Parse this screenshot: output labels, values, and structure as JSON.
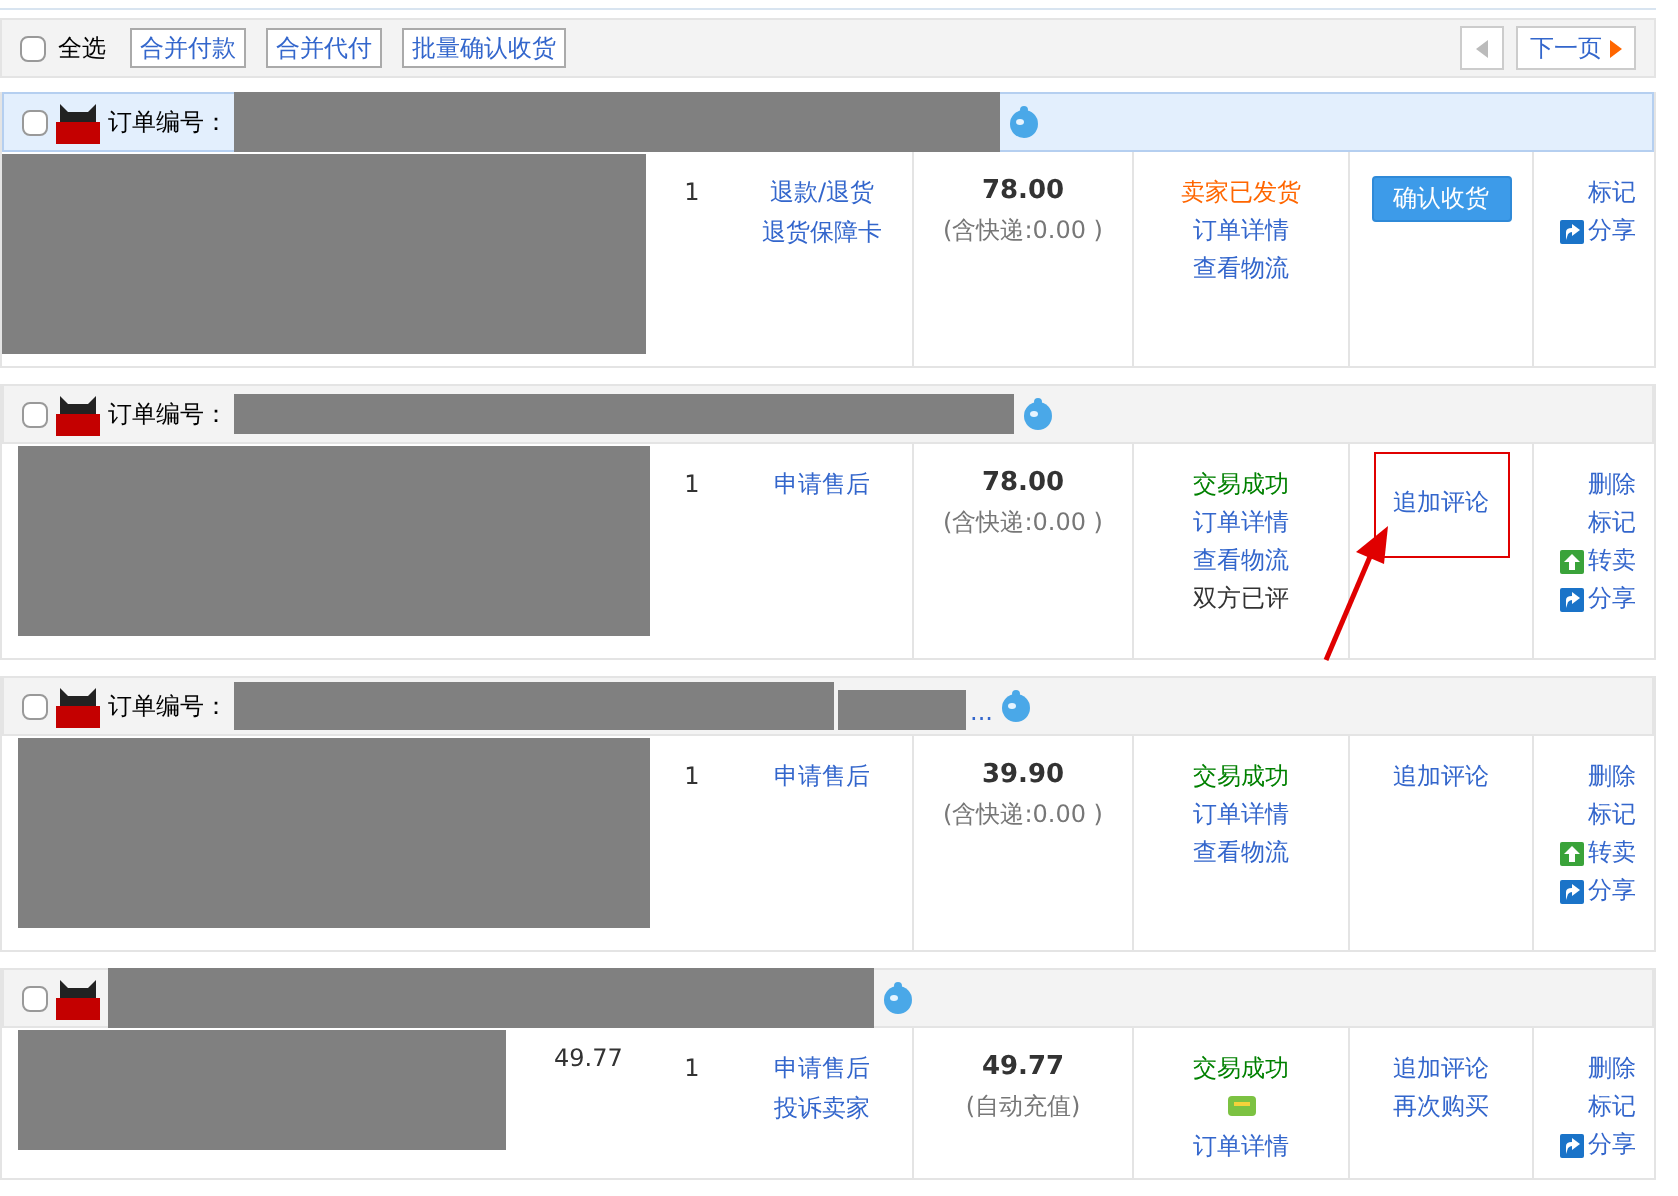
{
  "toolbar": {
    "select_all": {
      "label": "全选",
      "checked": false
    },
    "buttons": [
      "合并付款",
      "合并代付",
      "批量确认收货"
    ],
    "pager": {
      "prev_disabled": true,
      "next": "下一页"
    }
  },
  "orders": [
    {
      "highlighted": true,
      "checked": false,
      "header_label": "订单编号：",
      "qty": "1",
      "service": [
        "退款/退货",
        "退货保障卡"
      ],
      "total": "78.00",
      "total_note": "(含快递:0.00 )",
      "status": [
        {
          "kind": "shipped",
          "text": "卖家已发货"
        },
        {
          "kind": "link",
          "text": "订单详情"
        },
        {
          "kind": "link",
          "text": "查看物流"
        }
      ],
      "actions": [
        {
          "kind": "button",
          "text": "确认收货",
          "annotated": false
        }
      ],
      "misc": [
        {
          "kind": "link",
          "text": "标记"
        },
        {
          "kind": "share",
          "text": "分享"
        }
      ]
    },
    {
      "highlighted": false,
      "checked": false,
      "header_label": "订单编号：",
      "qty": "1",
      "service": [
        "申请售后"
      ],
      "total": "78.00",
      "total_note": "(含快递:0.00 )",
      "status": [
        {
          "kind": "success",
          "text": "交易成功"
        },
        {
          "kind": "link",
          "text": "订单详情"
        },
        {
          "kind": "link",
          "text": "查看物流"
        },
        {
          "kind": "text",
          "text": "双方已评"
        }
      ],
      "actions": [
        {
          "kind": "link",
          "text": "追加评论",
          "annotated": true
        }
      ],
      "misc": [
        {
          "kind": "link",
          "text": "删除"
        },
        {
          "kind": "link",
          "text": "标记"
        },
        {
          "kind": "resell",
          "text": "转卖"
        },
        {
          "kind": "share",
          "text": "分享"
        }
      ]
    },
    {
      "highlighted": false,
      "checked": false,
      "header_label": "订单编号：",
      "ellipsis": "...",
      "qty": "1",
      "service": [
        "申请售后"
      ],
      "total": "39.90",
      "total_note": "(含快递:0.00 )",
      "status": [
        {
          "kind": "success",
          "text": "交易成功"
        },
        {
          "kind": "link",
          "text": "订单详情"
        },
        {
          "kind": "link",
          "text": "查看物流"
        }
      ],
      "actions": [
        {
          "kind": "link",
          "text": "追加评论",
          "annotated": false
        }
      ],
      "misc": [
        {
          "kind": "link",
          "text": "删除"
        },
        {
          "kind": "link",
          "text": "标记"
        },
        {
          "kind": "resell",
          "text": "转卖"
        },
        {
          "kind": "share",
          "text": "分享"
        }
      ]
    },
    {
      "highlighted": false,
      "checked": false,
      "unit_price": "49.77",
      "qty": "1",
      "service": [
        "申请售后",
        "投诉卖家"
      ],
      "total": "49.77",
      "total_note": "(自动充值)",
      "status": [
        {
          "kind": "success",
          "text": "交易成功"
        },
        {
          "kind": "icon"
        },
        {
          "kind": "link",
          "text": "订单详情"
        }
      ],
      "actions": [
        {
          "kind": "link",
          "text": "追加评论",
          "annotated": false
        },
        {
          "kind": "link",
          "text": "再次购买",
          "annotated": false
        }
      ],
      "misc": [
        {
          "kind": "link",
          "text": "删除"
        },
        {
          "kind": "link",
          "text": "标记"
        },
        {
          "kind": "share",
          "text": "分享"
        }
      ]
    }
  ]
}
